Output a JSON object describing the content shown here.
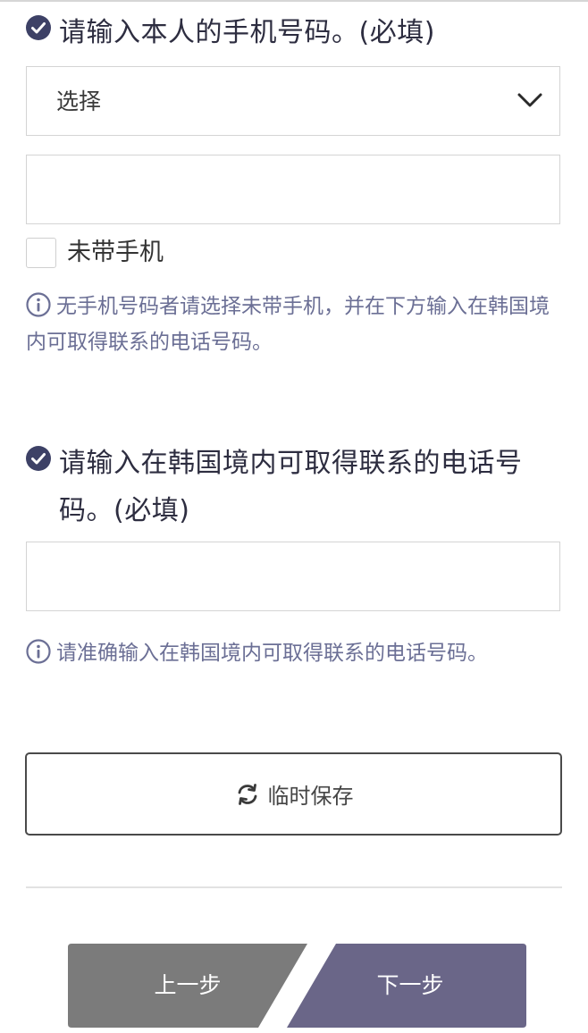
{
  "colors": {
    "accent": "#3d4166",
    "info_text": "#6b6f95",
    "prev_button": "#7b7b7b",
    "next_button": "#6a6688"
  },
  "phone_section": {
    "heading": "请输入本人的手机号码。(必填)",
    "select": {
      "selected_value": "选择",
      "icon": "chevron-down-icon"
    },
    "phone_input": {
      "value": ""
    },
    "no_phone_checkbox": {
      "label": "未带手机",
      "checked": false
    },
    "info_text": "无手机号码者请选择未带手机，并在下方输入在韩国境内可取得联系的电话号码。"
  },
  "korea_contact_section": {
    "heading": "请输入在韩国境内可取得联系的电话号码。(必填)",
    "contact_input": {
      "value": ""
    },
    "info_text": "请准确输入在韩国境内可取得联系的电话号码。"
  },
  "actions": {
    "temp_save_label": "临时保存",
    "temp_save_icon": "refresh-icon",
    "prev_label": "上一步",
    "next_label": "下一步"
  }
}
